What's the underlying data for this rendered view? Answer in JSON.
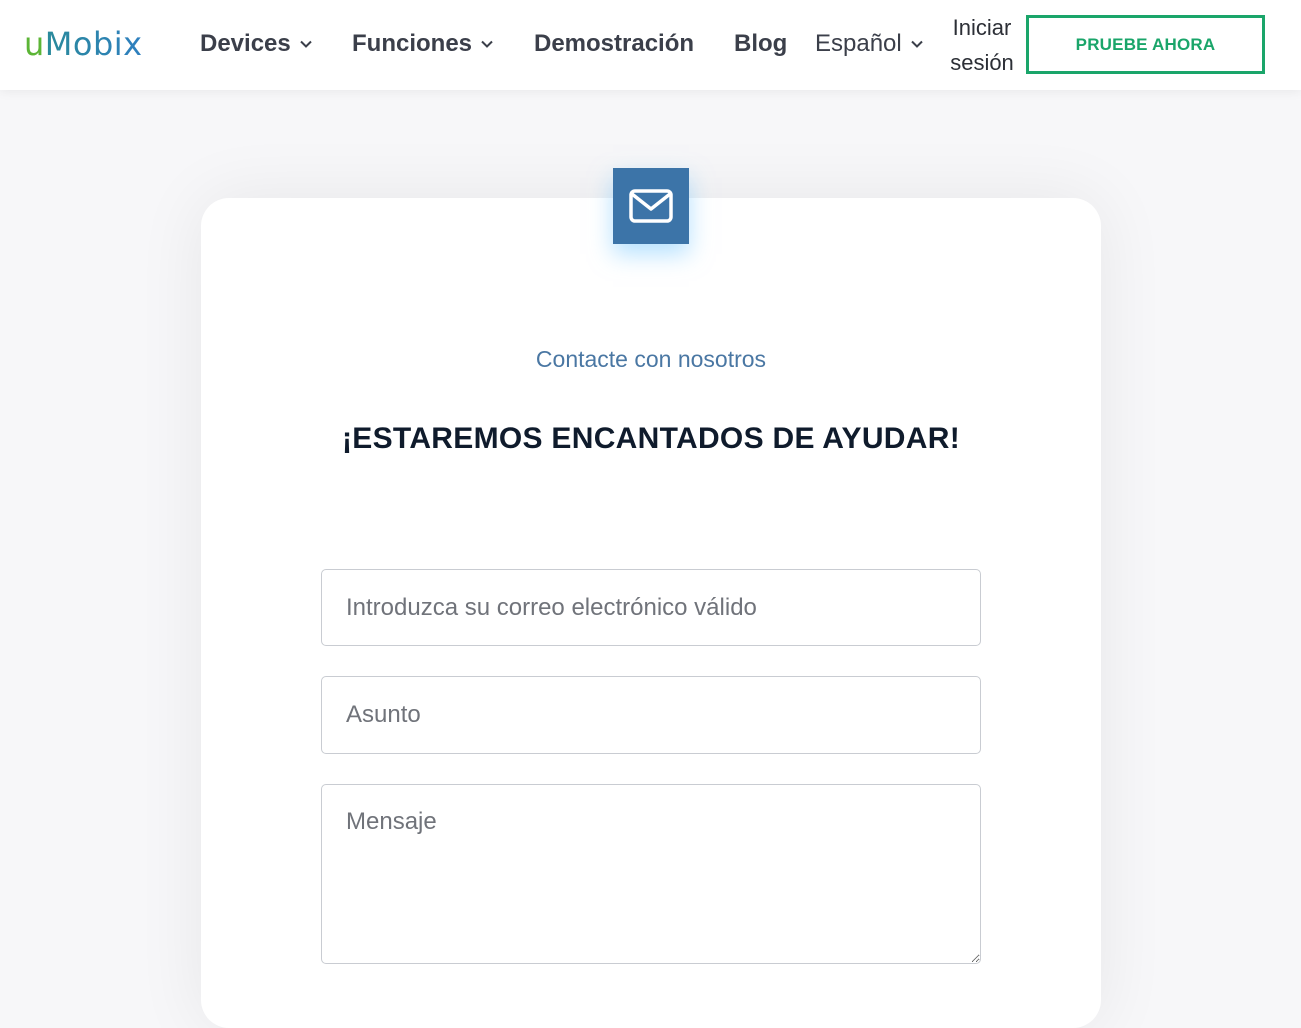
{
  "header": {
    "logo": {
      "first": "u",
      "rest": "Mobix"
    },
    "nav": {
      "devices": "Devices",
      "funciones": "Funciones",
      "demostracion": "Demostración",
      "blog": "Blog",
      "language": "Español"
    },
    "login_line1": "Iniciar",
    "login_line2": "sesión",
    "cta": "PRUEBE AHORA"
  },
  "contact": {
    "icon": "envelope-icon",
    "subtitle": "Contacte con nosotros",
    "headline": "¡ESTAREMOS ENCANTADOS DE AYUDAR!",
    "email_placeholder": "Introduzca su correo electrónico válido",
    "subject_placeholder": "Asunto",
    "message_placeholder": "Mensaje"
  },
  "colors": {
    "accent_green": "#1aa56a",
    "badge_blue": "#3c74a8",
    "subtitle_blue": "#4a77a3",
    "headline_dark": "#0f1b2c"
  }
}
